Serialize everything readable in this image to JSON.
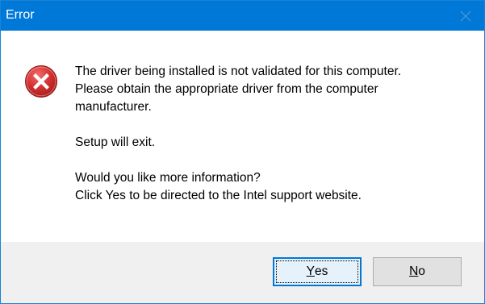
{
  "window": {
    "title": "Error",
    "close_icon": "close-icon"
  },
  "dialog": {
    "icon": "error-icon",
    "icon_color": "#d32f2f",
    "message": {
      "line1": "The driver being installed is not validated for this computer.\nPlease obtain the appropriate driver from the computer\nmanufacturer.",
      "line2": "Setup will exit.",
      "line3": "Would you like more information?\nClick Yes to be directed to the Intel support website."
    }
  },
  "buttons": {
    "yes": {
      "mnemonic": "Y",
      "rest": "es"
    },
    "no": {
      "mnemonic": "N",
      "rest": "o"
    }
  },
  "colors": {
    "titlebar": "#0078d7",
    "footer": "#f0f0f0",
    "default_button_border": "#0078d7"
  }
}
